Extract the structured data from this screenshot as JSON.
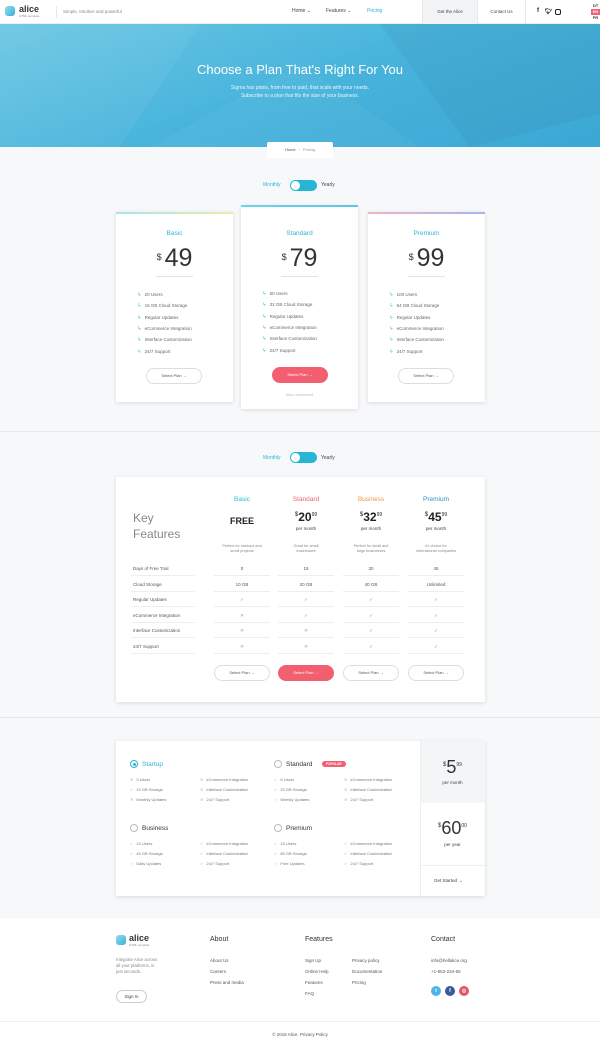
{
  "header": {
    "brand": "alice",
    "brand_sub": "HTML template",
    "tagline": "Simple, Intuitive and powerful",
    "nav": [
      {
        "label": "Home ⌄"
      },
      {
        "label": "Features ⌄"
      },
      {
        "label": "Pricing"
      }
    ],
    "get_button": "Get the Alice",
    "contact_button": "Contact Us",
    "social": [
      "f",
      "t",
      "ig"
    ],
    "languages": [
      "DT",
      "EN",
      "FR"
    ],
    "active_language": "EN"
  },
  "hero": {
    "title": "Choose a Plan That's Right For You",
    "line1": "Sigma has plans, from free to paid, that scale with your needs.",
    "line2": "Subscribe to a plan that fits the size of your business."
  },
  "breadcrumb": {
    "home": "Home",
    "sep": "/",
    "current": "Pricing"
  },
  "toggle1": {
    "monthly": "Monthly",
    "yearly": "Yearly"
  },
  "plans": [
    {
      "name": "Basic",
      "currency": "$",
      "price": "49",
      "features": [
        "20 Users",
        "16 GB Cloud Storage",
        "Regular Updates",
        "eCommerce Integration",
        "Interface Customization",
        "24/7 Support"
      ],
      "button": "Select Plan  →"
    },
    {
      "name": "Standard",
      "currency": "$",
      "price": "79",
      "features": [
        "50 Users",
        "32 GB Cloud Storage",
        "Regular Updates",
        "eCommerce Integration",
        "Interface Customization",
        "24/7 Support"
      ],
      "button": "Select Plan  →",
      "note": "Alice recommend"
    },
    {
      "name": "Premium",
      "currency": "$",
      "price": "99",
      "features": [
        "100 Users",
        "64 GB Cloud Storage",
        "Regular Updates",
        "eCommerce Integration",
        "Interface Customization",
        "24/7 Support"
      ],
      "button": "Select Plan  →"
    }
  ],
  "toggle2": {
    "monthly": "Monthly",
    "yearly": "Yearly"
  },
  "compare": {
    "heading1": "Key",
    "heading2": "Features",
    "columns": [
      {
        "name": "Basic",
        "price_text": "FREE",
        "desc1": "Perfect for startups and",
        "desc2": "small projects",
        "color": "#2eb4d6"
      },
      {
        "name": "Standard",
        "currency": "$",
        "int": "20",
        "cents": "99",
        "per": "per month",
        "desc1": "Great for small",
        "desc2": "businesses",
        "color": "#f25f70"
      },
      {
        "name": "Business",
        "currency": "$",
        "int": "32",
        "cents": "99",
        "per": "per month",
        "desc1": "Perfect for small and",
        "desc2": "large businesses",
        "color": "#f0963c"
      },
      {
        "name": "Premium",
        "currency": "$",
        "int": "45",
        "cents": "99",
        "per": "per month",
        "desc1": "#1 choice for",
        "desc2": "international companies",
        "color": "#2f8fc8"
      }
    ],
    "rows": [
      {
        "label": "Days of Free Trial",
        "cells": [
          "0",
          "15",
          "30",
          "45"
        ]
      },
      {
        "label": "Cloud Storage",
        "cells": [
          "10 GB",
          "20 GB",
          "40 GB",
          "Unlimited"
        ]
      },
      {
        "label": "Regular Updates",
        "cells": [
          "✓",
          "✓",
          "✓",
          "✓"
        ]
      },
      {
        "label": "eCommerce Integration",
        "cells": [
          "✕",
          "✓",
          "✓",
          "✓"
        ]
      },
      {
        "label": "Interface Customization",
        "cells": [
          "✕",
          "✕",
          "✓",
          "✓"
        ]
      },
      {
        "label": "24/7 Support",
        "cells": [
          "✕",
          "✕",
          "✓",
          "✓"
        ]
      }
    ],
    "button": "Select Plan  →"
  },
  "picker": {
    "plans": [
      {
        "name": "Startup",
        "selected": true,
        "left": [
          "3 Users",
          "10 GB Storage",
          "Monthly Updates"
        ],
        "left_marks": [
          "✕",
          "✓",
          "✕"
        ],
        "right": [
          "eCommerce Integration",
          "Interface Customization",
          "24/7 Support"
        ],
        "right_marks": [
          "✕",
          "✕",
          "✕"
        ]
      },
      {
        "name": "Standard",
        "badge": "POPULAR",
        "left": [
          "5 Users",
          "20 GB Storage",
          "Weekly Updates"
        ],
        "left_marks": [
          "✓",
          "✓",
          "✓"
        ],
        "right": [
          "eCommerce Integration",
          "Interface Customization",
          "24/7 Support"
        ],
        "right_marks": [
          "✕",
          "✕",
          "✕"
        ]
      },
      {
        "name": "Business",
        "left": [
          "10 Users",
          "40 GB Storage",
          "Daily Updates"
        ],
        "left_marks": [
          "✓",
          "✓",
          "✓"
        ],
        "right": [
          "eCommerce Integration",
          "Interface Customization",
          "24/7 Support"
        ],
        "right_marks": [
          "✓",
          "✓",
          "✓"
        ]
      },
      {
        "name": "Premium",
        "left": [
          "15 Users",
          "80 GB Storage",
          "Free Updates"
        ],
        "left_marks": [
          "✓",
          "✓",
          "✓"
        ],
        "right": [
          "eCommerce Integration",
          "Interface Customization",
          "24/7 Support"
        ],
        "right_marks": [
          "✓",
          "✓",
          "✓"
        ]
      }
    ],
    "monthly": {
      "currency": "$",
      "int": "5",
      "cents": "99",
      "per": "per month"
    },
    "yearly": {
      "currency": "$",
      "int": "60",
      "cents": "00",
      "per": "per year"
    },
    "get_started": "Get Started  →"
  },
  "footer": {
    "brand": "alice",
    "brand_sub": "HTML template",
    "desc": [
      "Integrate Alice across",
      "all your platforms, in",
      "just seconds."
    ],
    "signin": "Sign In",
    "about_title": "About",
    "about": [
      "About Us",
      "Careers",
      "Press and media"
    ],
    "features_title": "Features",
    "features_a": [
      "Sign Up",
      "Online Help",
      "Features",
      "FAQ"
    ],
    "features_b": [
      "Privacy policy",
      "Documentation",
      "Pricing"
    ],
    "contact_title": "Contact",
    "email": "info@hellalice.org",
    "phone": "+1-853-234-65",
    "copyright": "© 2018 Alice. Privacy Policy"
  }
}
